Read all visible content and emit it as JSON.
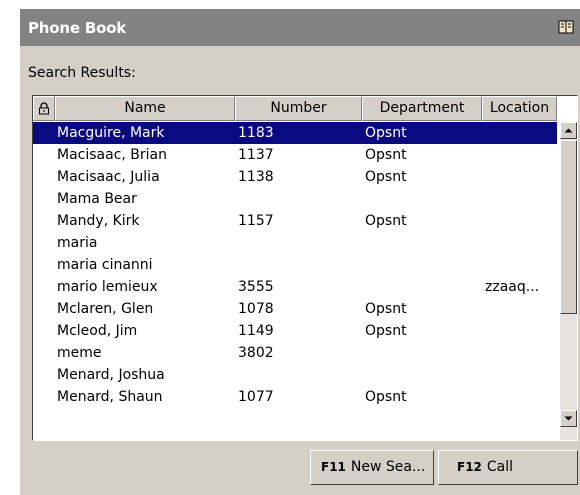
{
  "window": {
    "title": "Phone Book",
    "icon": "book-icon"
  },
  "search_label": "Search Results:",
  "table": {
    "lock_icon": "lock-icon",
    "columns": [
      "Name",
      "Number",
      "Department",
      "Location"
    ],
    "selected_index": 0,
    "rows": [
      {
        "name": "Macguire, Mark",
        "number": "1183",
        "department": "Opsnt",
        "location": ""
      },
      {
        "name": "Macisaac, Brian",
        "number": "1137",
        "department": "Opsnt",
        "location": ""
      },
      {
        "name": "Macisaac, Julia",
        "number": "1138",
        "department": "Opsnt",
        "location": ""
      },
      {
        "name": "Mama Bear",
        "number": "",
        "department": "",
        "location": ""
      },
      {
        "name": "Mandy, Kirk",
        "number": "1157",
        "department": "Opsnt",
        "location": ""
      },
      {
        "name": "maria",
        "number": "",
        "department": "",
        "location": ""
      },
      {
        "name": "maria cinanni",
        "number": "",
        "department": "",
        "location": ""
      },
      {
        "name": "mario lemieux",
        "number": "3555",
        "department": "",
        "location": "zzaaq..."
      },
      {
        "name": "Mclaren, Glen",
        "number": "1078",
        "department": "Opsnt",
        "location": ""
      },
      {
        "name": "Mcleod, Jim",
        "number": "1149",
        "department": "Opsnt",
        "location": ""
      },
      {
        "name": "meme",
        "number": "3802",
        "department": "",
        "location": ""
      },
      {
        "name": "Menard, Joshua",
        "number": "",
        "department": "",
        "location": ""
      },
      {
        "name": "Menard, Shaun",
        "number": "1077",
        "department": "Opsnt",
        "location": ""
      }
    ]
  },
  "buttons": {
    "new_search": {
      "key": "F11",
      "label": "New Sea..."
    },
    "call": {
      "key": "F12",
      "label": "Call"
    }
  }
}
